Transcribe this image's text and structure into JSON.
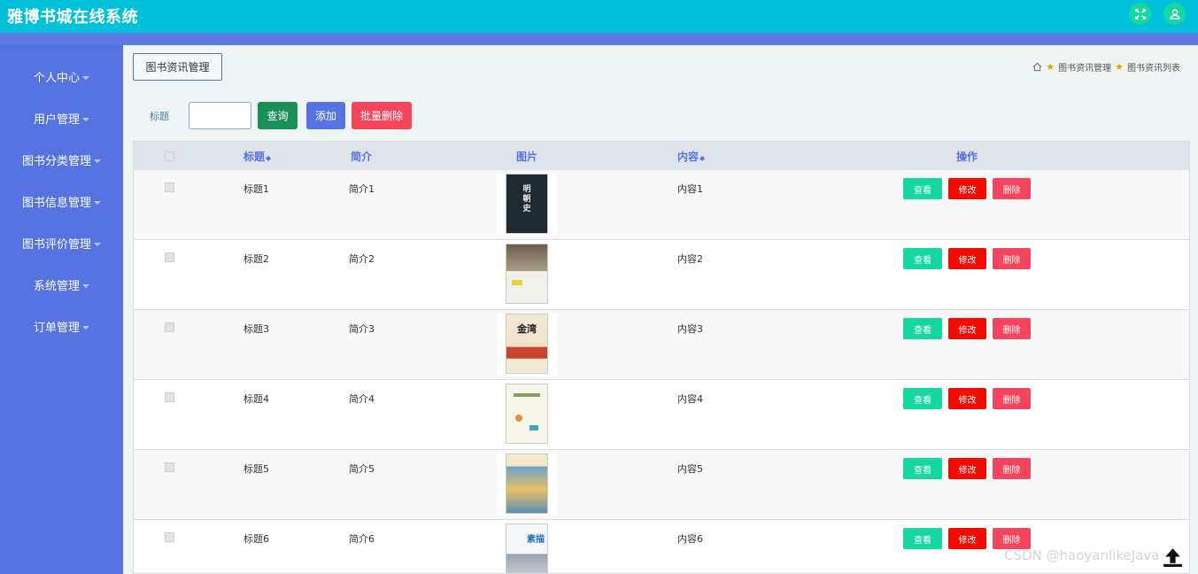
{
  "app": {
    "title": "雅博书城在线系统"
  },
  "topbar": {
    "icons": [
      "fullscreen-icon",
      "user-icon"
    ]
  },
  "sidebar": {
    "items": [
      {
        "label": "个人中心"
      },
      {
        "label": "用户管理"
      },
      {
        "label": "图书分类管理"
      },
      {
        "label": "图书信息管理"
      },
      {
        "label": "图书评价管理"
      },
      {
        "label": "系统管理"
      },
      {
        "label": "订单管理"
      }
    ]
  },
  "page": {
    "section_title": "图书资讯管理",
    "breadcrumb": [
      "图书资讯管理",
      "图书资讯列表"
    ]
  },
  "search": {
    "label": "标题",
    "value": "",
    "query_label": "查询",
    "add_label": "添加",
    "batch_delete_label": "批量删除"
  },
  "table": {
    "headers": {
      "title": "标题",
      "intro": "简介",
      "image": "图片",
      "content": "内容",
      "actions": "操作"
    },
    "rows": [
      {
        "title": "标题1",
        "intro": "简介1",
        "content": "内容1",
        "cover_text": "明\n朝\n史"
      },
      {
        "title": "标题2",
        "intro": "简介2",
        "content": "内容2",
        "cover_text": ""
      },
      {
        "title": "标题3",
        "intro": "简介3",
        "content": "内容3",
        "cover_text": "金湾"
      },
      {
        "title": "标题4",
        "intro": "简介4",
        "content": "内容4",
        "cover_text": ""
      },
      {
        "title": "标题5",
        "intro": "简介5",
        "content": "内容5",
        "cover_text": ""
      },
      {
        "title": "标题6",
        "intro": "简介6",
        "content": "内容6",
        "cover_text": "素描"
      }
    ],
    "row_actions": {
      "view": "查看",
      "edit": "修改",
      "delete": "删除"
    }
  },
  "watermark": "CSDN @haoyanlikeJava",
  "colors": {
    "topbar": "#00c0da",
    "sidebar": "#5673e1",
    "accent_green": "#17d7a0",
    "danger_red": "#f50a00",
    "delete_pink": "#f5455e",
    "query_green": "#1b8f58"
  }
}
